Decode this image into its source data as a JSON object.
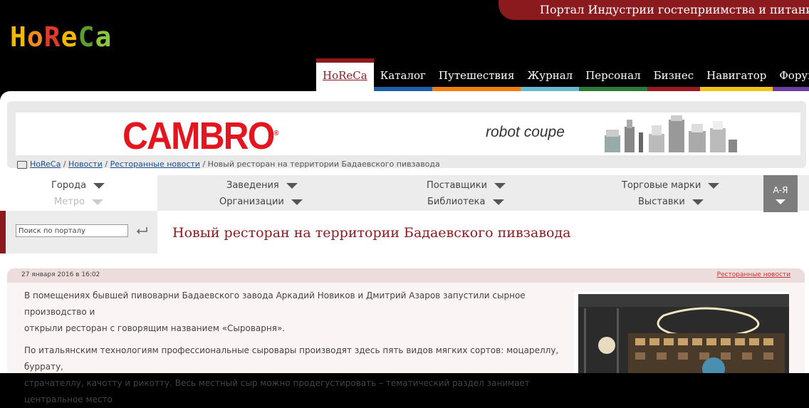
{
  "header": {
    "tagline": "Портал Индустрии гостеприимства и питания",
    "logo": [
      "H",
      "o",
      "R",
      "e",
      "C",
      "a"
    ],
    "logo_colors": [
      "#f5b800",
      "#f08a1c",
      "#e03a2a",
      "#f5b800",
      "#5aa02c",
      "#8cc63f"
    ]
  },
  "nav": {
    "items": [
      {
        "label": "HoReCa",
        "color": "#8b1a1f",
        "active": true
      },
      {
        "label": "Каталог",
        "color": "#1e5fa8"
      },
      {
        "label": "Путешествия",
        "color": "#f07c12"
      },
      {
        "label": "Журнал",
        "color": "#6bb9cf"
      },
      {
        "label": "Персонал",
        "color": "#2f7a3a"
      },
      {
        "label": "Бизнес",
        "color": "#9a1a23"
      },
      {
        "label": "Навигатор",
        "color": "#f0c419"
      },
      {
        "label": "Форум",
        "color": "#6a3fa0"
      }
    ]
  },
  "banner": {
    "left_brand": "CAMBRO",
    "right_brand": "robot coupe"
  },
  "breadcrumb": {
    "links": [
      "HoReCa",
      "Новости",
      "Ресторанные новости"
    ],
    "current": "Новый ресторан на территории Бадаевского пивзавода"
  },
  "filters": {
    "cities": "Города",
    "metro": "Метро",
    "venues": "Заведения",
    "organizations": "Организации",
    "suppliers": "Поставщики",
    "library": "Библиотека",
    "brands": "Торговые марки",
    "exhibitions": "Выставки",
    "az": "А-Я"
  },
  "search": {
    "placeholder": "Поиск по порталу"
  },
  "article": {
    "title": "Новый ресторан на территории Бадаевского пивзавода",
    "date": "27 января 2016 в 16:02",
    "category": "Ресторанные новости",
    "p1_line1": "В помещениях бывшей пивоварни Бадаевского завода Аркадий Новиков и Дмитрий Азаров запустили сырное производство и",
    "p1_line2": "открыли ресторан с говорящим названием «Сыроварня».",
    "p2_line1": "По итальянским технологиям профессиональные сыровары производят здесь пять видов мягких сортов: моцареллу, буррату,",
    "p2_line2": "страчателлу, качотту и рикотту. Весь местный сыр можно продегустировать – тематический раздел занимает центральное место"
  }
}
